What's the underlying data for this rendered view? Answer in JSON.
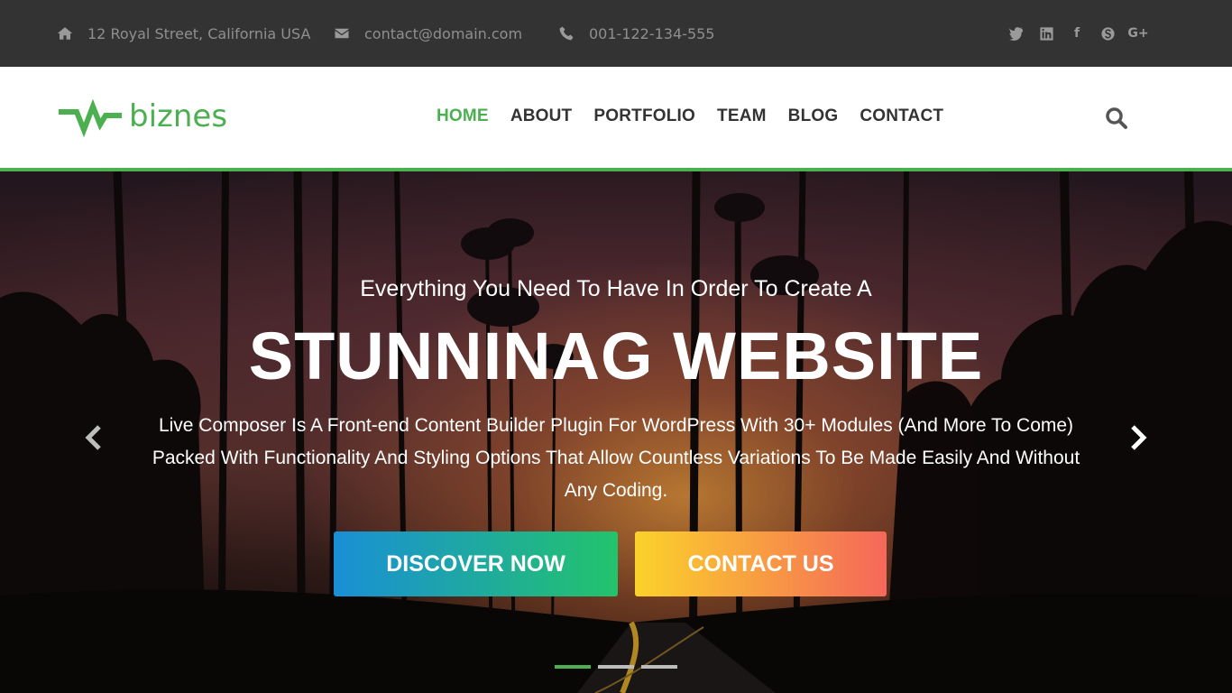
{
  "topbar": {
    "address": "12 Royal Street, California USA",
    "email": "contact@domain.com",
    "phone": "001-122-134-555",
    "social": [
      {
        "name": "twitter-icon"
      },
      {
        "name": "linkedin-icon",
        "glyph": "in"
      },
      {
        "name": "facebook-icon",
        "glyph": "f"
      },
      {
        "name": "skype-icon"
      },
      {
        "name": "google-plus-icon",
        "glyph": "G+"
      }
    ]
  },
  "header": {
    "logo_text": "biznes",
    "nav": [
      {
        "label": "HOME",
        "active": true
      },
      {
        "label": "ABOUT"
      },
      {
        "label": "PORTFOLIO"
      },
      {
        "label": "TEAM"
      },
      {
        "label": "BLOG"
      },
      {
        "label": "CONTACT"
      }
    ]
  },
  "hero": {
    "pre_title": "Everything You Need To Have In Order To Create A",
    "title": "STUNNINAG WEBSITE",
    "description": "Live Composer Is A Front-end Content Builder Plugin For WordPress With 30+ Modules (And More To Come) Packed With Functionality And Styling Options That Allow Countless Variations To Be Made Easily And Without Any Coding.",
    "primary_button": "DISCOVER NOW",
    "secondary_button": "CONTACT US",
    "slides_total": 3,
    "active_slide": 1
  },
  "colors": {
    "accent": "#4caf50",
    "topbar_bg": "#333333",
    "discover_gradient": [
      "#1a8fd6",
      "#23c36b"
    ],
    "contact_gradient": [
      "#fbd22a",
      "#f5675a"
    ]
  }
}
